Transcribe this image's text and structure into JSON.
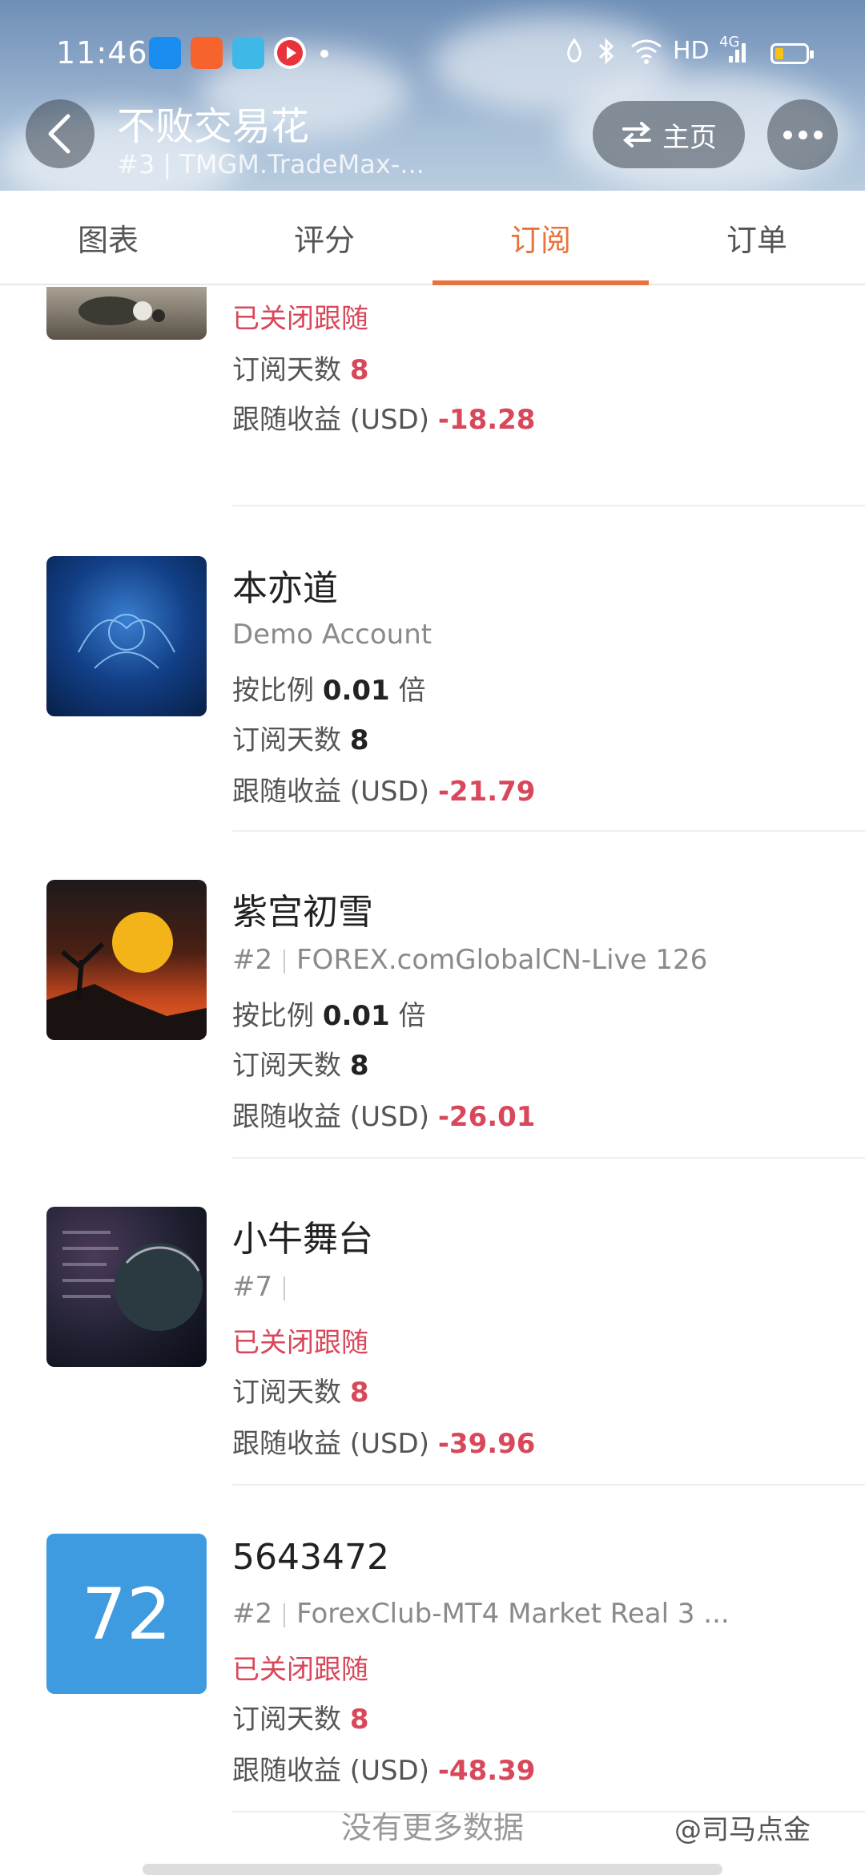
{
  "status_bar": {
    "time": "11:46",
    "network": "HD",
    "signal": "4G"
  },
  "header": {
    "title": "不败交易花",
    "subtitle": "#3 | TMGM.TradeMax-...",
    "home_label": "主页"
  },
  "tabs": [
    {
      "label": "图表"
    },
    {
      "label": "评分"
    },
    {
      "label": "订阅",
      "active": true
    },
    {
      "label": "订单"
    }
  ],
  "items": [
    {
      "status": "已关闭跟随",
      "days_label": "订阅天数",
      "days": "8",
      "profit_label": "跟随收益 (USD)",
      "profit": "-18.28"
    },
    {
      "name": "本亦道",
      "account": "Demo Account",
      "ratio_prefix": "按比例",
      "ratio": "0.01",
      "ratio_suffix": "倍",
      "days_label": "订阅天数",
      "days": "8",
      "profit_label": "跟随收益 (USD)",
      "profit": "-21.79"
    },
    {
      "name": "紫宫初雪",
      "rank": "#2",
      "server": "FOREX.comGlobalCN-Live 126",
      "ratio_prefix": "按比例",
      "ratio": "0.01",
      "ratio_suffix": "倍",
      "days_label": "订阅天数",
      "days": "8",
      "profit_label": "跟随收益 (USD)",
      "profit": "-26.01"
    },
    {
      "name": "小牛舞台",
      "rank": "#7",
      "status": "已关闭跟随",
      "days_label": "订阅天数",
      "days": "8",
      "profit_label": "跟随收益 (USD)",
      "profit": "-39.96"
    },
    {
      "name": "5643472",
      "avatar_text": "72",
      "rank": "#2",
      "server": "ForexClub-MT4 Market Real 3 ...",
      "status": "已关闭跟随",
      "days_label": "订阅天数",
      "days": "8",
      "profit_label": "跟随收益 (USD)",
      "profit": "-48.39"
    }
  ],
  "footer": {
    "text": "没有更多数据",
    "watermark": "@司马点金"
  },
  "colors": {
    "accent": "#e8743b",
    "negative": "#d9475a",
    "avatar_blue": "#3f9be0"
  }
}
